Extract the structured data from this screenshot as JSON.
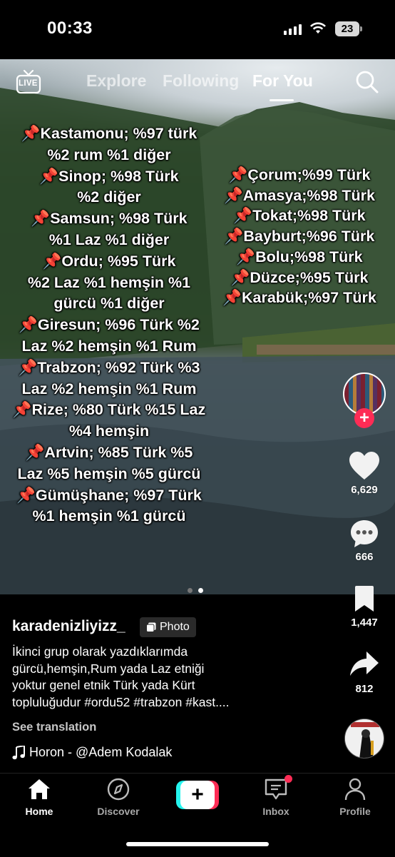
{
  "status_bar": {
    "time": "00:33",
    "battery": "23"
  },
  "top_nav": {
    "live_label": "LIVE",
    "tabs": [
      "Explore",
      "Following",
      "For You"
    ],
    "active_tab": "For You"
  },
  "overlay": {
    "left_lines": [
      "📌Kastamonu; %97 türk",
      "%2 rum %1 diğer",
      "📌Sinop; %98 Türk",
      "%2 diğer",
      "📌Samsun; %98 Türk",
      "%1 Laz %1 diğer",
      "📌Ordu; %95 Türk",
      "%2 Laz %1 hemşin %1",
      "gürcü %1 diğer",
      "📌Giresun; %96 Türk %2",
      "Laz %2 hemşin %1 Rum",
      "📌Trabzon; %92 Türk %3",
      "Laz %2 hemşin %1 Rum",
      "📌Rize; %80 Türk %15 Laz",
      "%4 hemşin",
      "📌Artvin; %85 Türk %5",
      "Laz %5 hemşin %5 gürcü",
      "📌Gümüşhane; %97 Türk",
      "%1 hemşin %1 gürcü"
    ],
    "right_lines": [
      "📌Çorum;%99 Türk",
      "📌Amasya;%98 Türk",
      "📌Tokat;%98 Türk",
      "📌Bayburt;%96 Türk",
      "📌Bolu;%98 Türk",
      "📌Düzce;%95 Türk",
      "📌Karabük;%97 Türk"
    ]
  },
  "actions": {
    "likes": "6,629",
    "comments": "666",
    "saves": "1,447",
    "shares": "812",
    "follow_symbol": "+"
  },
  "post": {
    "username": "karadenizliyizz_",
    "badge": "Photo",
    "caption_lines": [
      "İkinci grup olarak yazdıklarımda",
      "gürcü,hemşin,Rum yada Laz etniği",
      "yoktur genel etnik Türk yada Kürt",
      "topluluğudur #ordu52 #trabzon #kast...."
    ],
    "see_translation": "See translation",
    "music": "Horon - @Adem Kodalak"
  },
  "tab_bar": {
    "home": "Home",
    "discover": "Discover",
    "create": "+",
    "inbox": "Inbox",
    "profile": "Profile"
  },
  "colors": {
    "accent": "#fe2c55",
    "cyan": "#25f4ee",
    "background": "#000000"
  },
  "icons": [
    "live-icon",
    "search-icon",
    "heart-icon",
    "comment-icon",
    "bookmark-icon",
    "share-icon",
    "music-note-icon",
    "home-icon",
    "compass-icon",
    "inbox-icon",
    "profile-icon",
    "photo-icon"
  ]
}
